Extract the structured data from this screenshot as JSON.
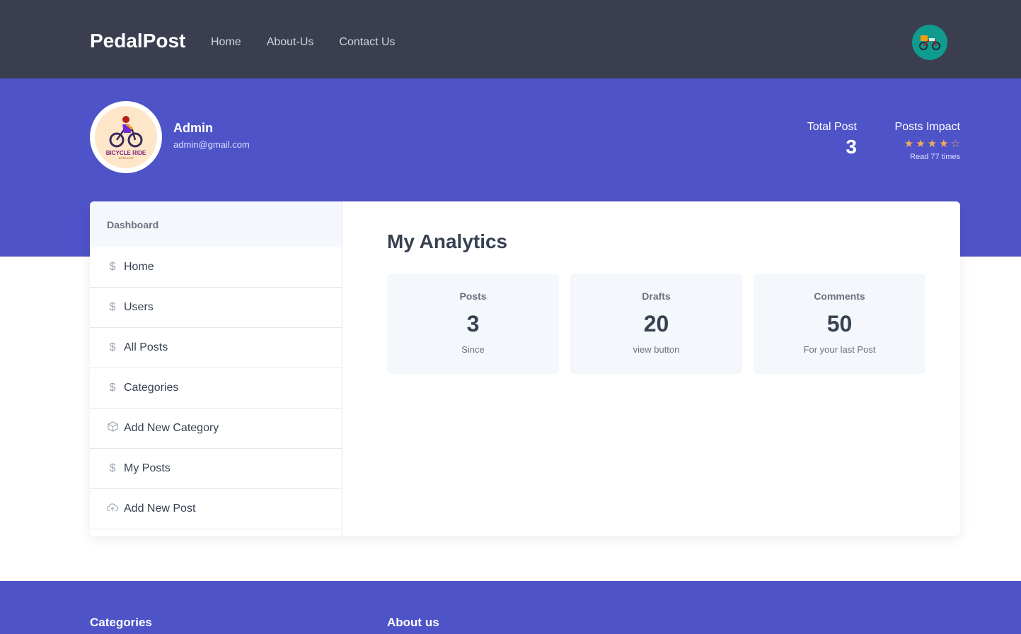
{
  "header": {
    "brand": "PedalPost",
    "nav": [
      "Home",
      "About-Us",
      "Contact Us"
    ],
    "avatar_icon": "bike-avatar-icon"
  },
  "profile": {
    "name": "Admin",
    "email": "admin@gmail.com",
    "avatar_text": "BICYCLE RIDE",
    "avatar_subtext": "ESTD 1978"
  },
  "stats": {
    "total_post_label": "Total Post",
    "total_post_value": "3",
    "impact_label": "Posts Impact",
    "rating": 4,
    "rating_max": 5,
    "reads_text": "Read 77 times"
  },
  "sidebar": {
    "title": "Dashboard",
    "items": [
      {
        "label": "Home",
        "icon": "dollar-icon"
      },
      {
        "label": "Users",
        "icon": "dollar-icon"
      },
      {
        "label": "All Posts",
        "icon": "dollar-icon"
      },
      {
        "label": "Categories",
        "icon": "dollar-icon"
      },
      {
        "label": "Add New Category",
        "icon": "box-icon"
      },
      {
        "label": "My Posts",
        "icon": "dollar-icon"
      },
      {
        "label": "Add New Post",
        "icon": "upload-cloud-icon"
      }
    ]
  },
  "main": {
    "title": "My Analytics",
    "tiles": [
      {
        "label": "Posts",
        "value": "3",
        "sub": "Since"
      },
      {
        "label": "Drafts",
        "value": "20",
        "sub": "view button"
      },
      {
        "label": "Comments",
        "value": "50",
        "sub": "For your last Post"
      }
    ]
  },
  "footer": {
    "categories_title": "Categories",
    "about_title": "About us"
  },
  "colors": {
    "topbar": "#3b3e4f",
    "accent": "#4f53c8",
    "star": "#f6ad55"
  }
}
